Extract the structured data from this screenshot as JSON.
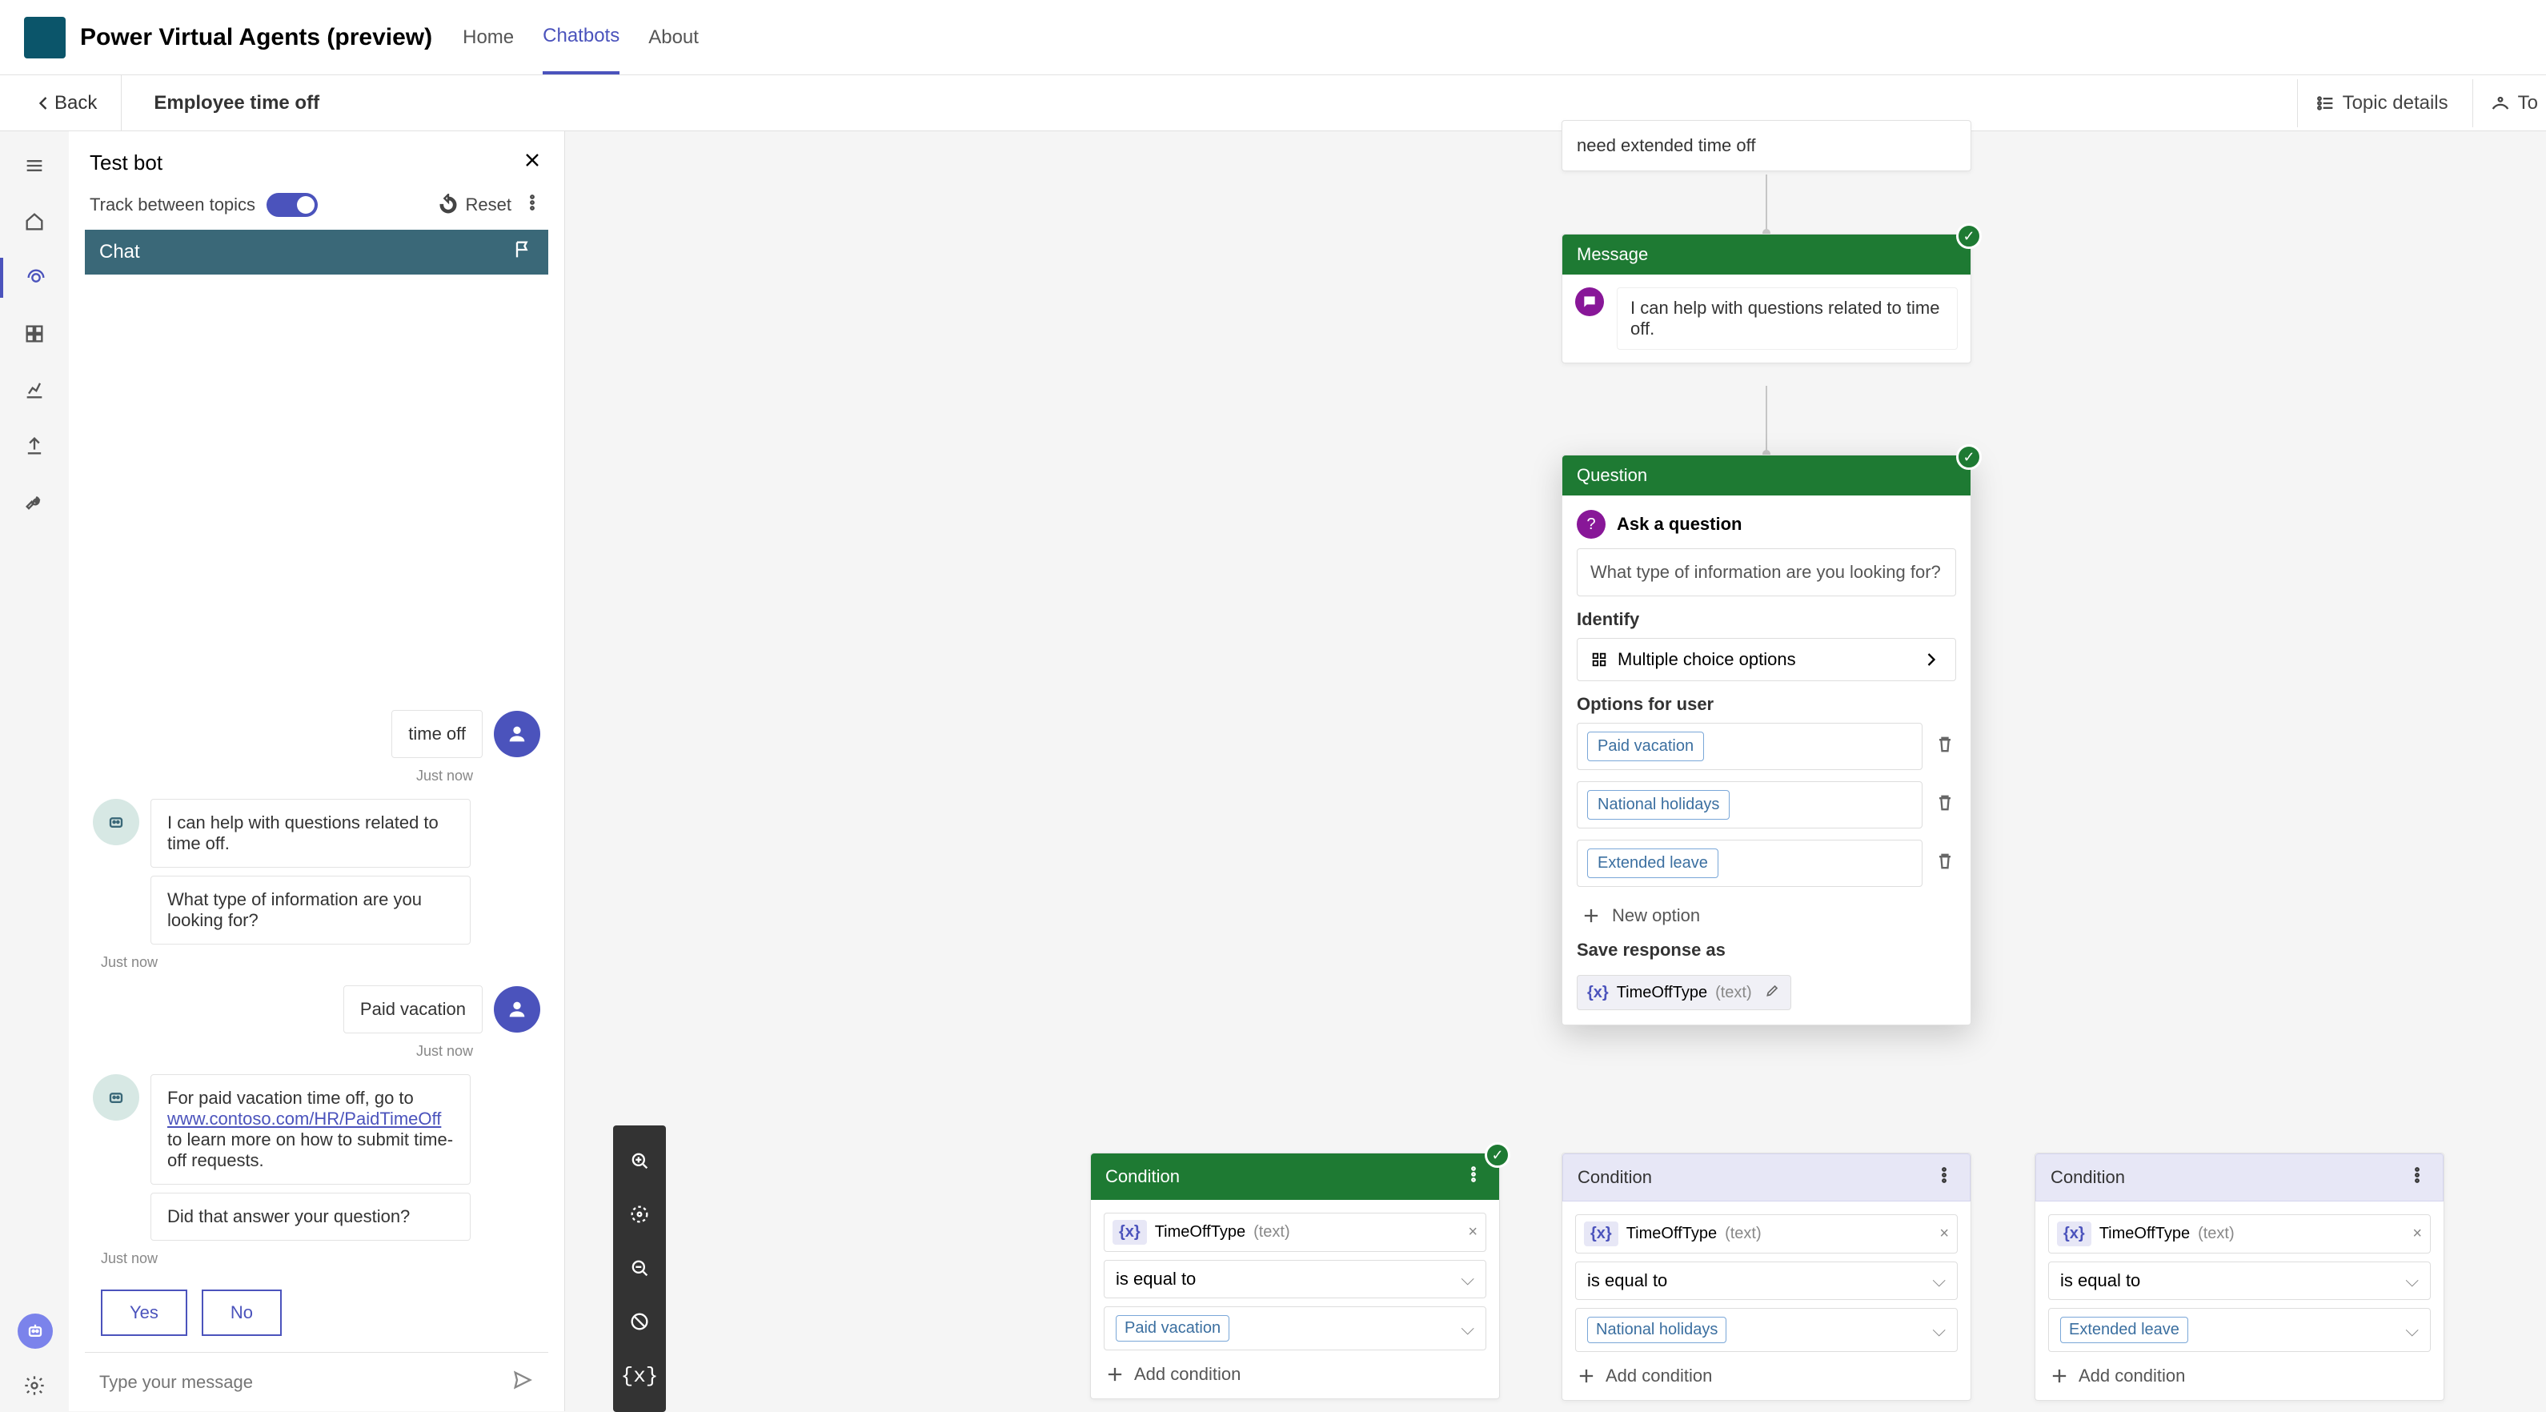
{
  "app": {
    "title": "Power Virtual Agents (preview)"
  },
  "top_tabs": {
    "home": "Home",
    "chatbots": "Chatbots",
    "about": "About"
  },
  "secondbar": {
    "back": "Back",
    "crumb": "Employee time off",
    "topic_details": "Topic details",
    "topic_checker": "To"
  },
  "testpanel": {
    "title": "Test bot",
    "track_label": "Track between topics",
    "reset": "Reset",
    "chat_header": "Chat",
    "user_msg1": "time off",
    "ts_just_now": "Just now",
    "bot_msg1": "I can help with questions related to time off.",
    "bot_msg2": "What type of information are you looking for?",
    "user_msg2": "Paid vacation",
    "bot_msg3_pre": "For paid vacation time off, go to ",
    "bot_msg3_link": "www.contoso.com/HR/PaidTimeOff",
    "bot_msg3_post": " to learn more on how to submit time-off requests.",
    "bot_msg4": "Did that answer your question?",
    "yes": "Yes",
    "no": "No",
    "placeholder": "Type your message"
  },
  "canvas": {
    "trigger_text": "need extended time off",
    "message_header": "Message",
    "message_text": "I can help with questions related to time off.",
    "question_header": "Question",
    "ask_label": "Ask a question",
    "question_text": "What type of information are you looking for?",
    "identify_label": "Identify",
    "identify_value": "Multiple choice options",
    "options_label": "Options for user",
    "options": {
      "o1": "Paid vacation",
      "o2": "National holidays",
      "o3": "Extended leave"
    },
    "new_option": "New option",
    "save_as_label": "Save response as",
    "var_name": "TimeOffType",
    "var_type": "(text)",
    "condition_header": "Condition",
    "op_equal": "is equal to",
    "add_condition": "Add condition",
    "cond_vals": {
      "c1": "Paid vacation",
      "c2": "National holidays",
      "c3": "Extended leave"
    }
  }
}
